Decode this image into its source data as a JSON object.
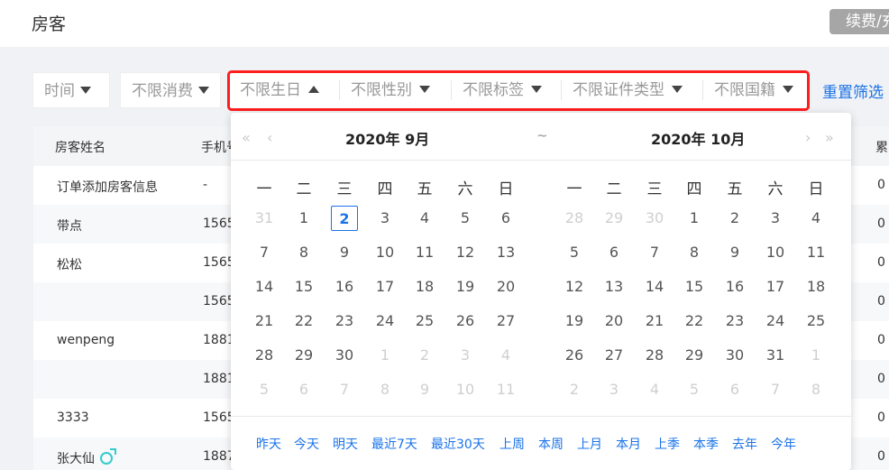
{
  "header": {
    "title": "房客",
    "renew_label": "续费/充值"
  },
  "filters": {
    "time": "时间",
    "spend": "不限消费",
    "birthday": "不限生日",
    "gender": "不限性别",
    "tag": "不限标签",
    "id_type": "不限证件类型",
    "nationality": "不限国籍",
    "reset": "重置筛选"
  },
  "table": {
    "columns": [
      "房客姓名",
      "手机号",
      "累"
    ],
    "rows": [
      {
        "name": "订单添加房客信息",
        "phone": "-",
        "extra": "0",
        "gender_icon": ""
      },
      {
        "name": "带点",
        "phone": "1565",
        "extra": "0",
        "gender_icon": ""
      },
      {
        "name": "松松",
        "phone": "1565",
        "extra": "0",
        "gender_icon": ""
      },
      {
        "name": "",
        "phone": "1565",
        "extra": "0",
        "gender_icon": ""
      },
      {
        "name": "wenpeng",
        "phone": "1881",
        "extra": "0",
        "gender_icon": ""
      },
      {
        "name": "",
        "phone": "1881",
        "extra": "0",
        "gender_icon": ""
      },
      {
        "name": "3333",
        "phone": "1565",
        "extra": "0",
        "gender_icon": ""
      },
      {
        "name": "张大仙",
        "phone": "1887",
        "extra": "0",
        "gender_icon": "male-icon"
      }
    ]
  },
  "date_picker": {
    "left": {
      "title": "2020年  9月"
    },
    "right": {
      "title": "2020年  10月"
    },
    "separator": "~",
    "nav": {
      "prev_year": "«",
      "prev_month": "‹",
      "next_month": "›",
      "next_year": "»"
    },
    "weekdays": [
      "一",
      "二",
      "三",
      "四",
      "五",
      "六",
      "日"
    ],
    "left_weeks": [
      [
        "31",
        "1",
        "2",
        "3",
        "4",
        "5",
        "6"
      ],
      [
        "7",
        "8",
        "9",
        "10",
        "11",
        "12",
        "13"
      ],
      [
        "14",
        "15",
        "16",
        "17",
        "18",
        "19",
        "20"
      ],
      [
        "21",
        "22",
        "23",
        "24",
        "25",
        "26",
        "27"
      ],
      [
        "28",
        "29",
        "30",
        "1",
        "2",
        "3",
        "4"
      ],
      [
        "5",
        "6",
        "7",
        "8",
        "9",
        "10",
        "11"
      ]
    ],
    "right_weeks": [
      [
        "28",
        "29",
        "30",
        "1",
        "2",
        "3",
        "4"
      ],
      [
        "5",
        "6",
        "7",
        "8",
        "9",
        "10",
        "11"
      ],
      [
        "12",
        "13",
        "14",
        "15",
        "16",
        "17",
        "18"
      ],
      [
        "19",
        "20",
        "21",
        "22",
        "23",
        "24",
        "25"
      ],
      [
        "26",
        "27",
        "28",
        "29",
        "30",
        "31",
        "1"
      ],
      [
        "2",
        "3",
        "4",
        "5",
        "6",
        "7",
        "8"
      ]
    ],
    "today": "2",
    "shortcuts": [
      "昨天",
      "今天",
      "明天",
      "最近7天",
      "最近30天",
      "上周",
      "本周",
      "上月",
      "本月",
      "上季",
      "本季",
      "去年",
      "今年"
    ]
  },
  "colors": {
    "accent": "#1a73e8",
    "highlight_border": "#ff1e1e",
    "muted_text": "#cfcfcf"
  }
}
